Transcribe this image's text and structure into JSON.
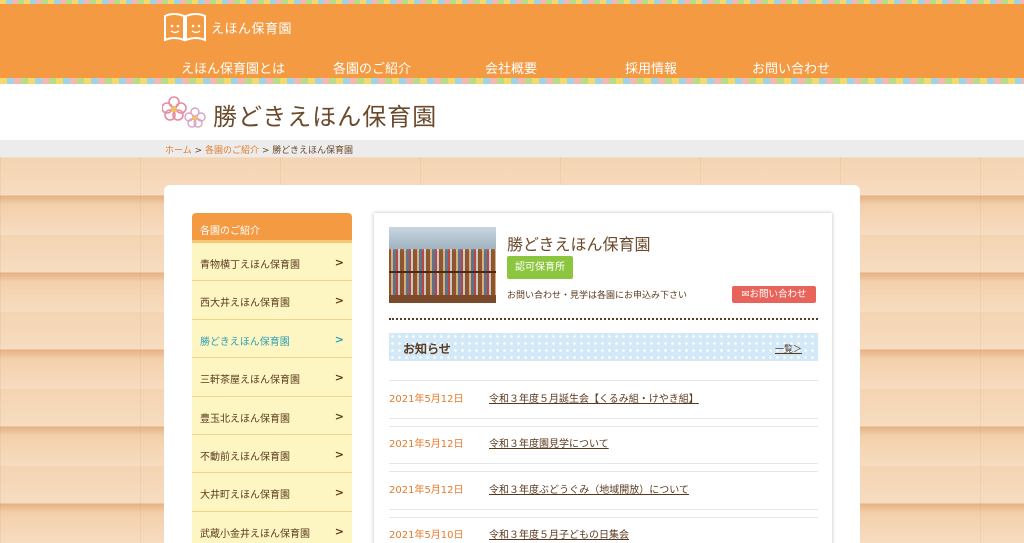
{
  "header": {
    "logo_text": "えほん保育園",
    "nav": [
      {
        "label": "えほん保育園とは"
      },
      {
        "label": "各園のご紹介"
      },
      {
        "label": "会社概要"
      },
      {
        "label": "採用情報"
      },
      {
        "label": "お問い合わせ"
      }
    ]
  },
  "page": {
    "title": "勝どきえほん保育園"
  },
  "breadcrumb": {
    "home": "ホーム",
    "sep1": " > ",
    "section": "各園のご紹介",
    "sep2": " > ",
    "current": "勝どきえほん保育園"
  },
  "sidebar": {
    "heading": "各園のご紹介",
    "items": [
      {
        "label": "青物横丁えほん保育園",
        "active": false
      },
      {
        "label": "西大井えほん保育園",
        "active": false
      },
      {
        "label": "勝どきえほん保育園",
        "active": true
      },
      {
        "label": "三軒茶屋えほん保育園",
        "active": false
      },
      {
        "label": "豊玉北えほん保育園",
        "active": false
      },
      {
        "label": "不動前えほん保育園",
        "active": false
      },
      {
        "label": "大井町えほん保育園",
        "active": false
      },
      {
        "label": "武蔵小金井えほん保育園",
        "active": false
      }
    ]
  },
  "school": {
    "name": "勝どきえほん保育園",
    "badge": "認可保育所",
    "note": "お問い合わせ・見学は各園にお申込み下さい",
    "contact_button": "お問い合わせ"
  },
  "news": {
    "heading": "お知らせ",
    "more_link": "一覧＞",
    "items": [
      {
        "date": "2021年5月12日",
        "title": "令和３年度５月誕生会【くるみ組・けやき組】"
      },
      {
        "date": "2021年5月12日",
        "title": "令和３年度園見学について"
      },
      {
        "date": "2021年5月12日",
        "title": "令和３年度ぶどうぐみ（地域開放）について"
      },
      {
        "date": "2021年5月10日",
        "title": "令和３年度５月子どもの日集会"
      }
    ]
  },
  "colors": {
    "header_orange": "#f39a43",
    "badge_green": "#8cc63f",
    "contact_red": "#e8645a",
    "active_teal": "#2e9fb3",
    "date_orange": "#e47b2c"
  }
}
